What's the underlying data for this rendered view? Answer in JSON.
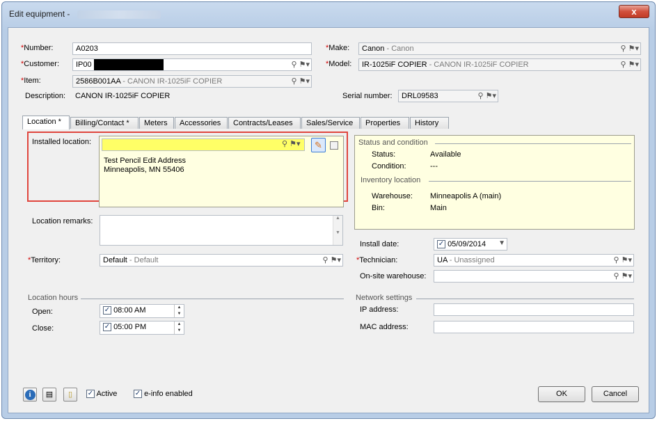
{
  "window": {
    "title": "Edit equipment -",
    "close_label": "x"
  },
  "header": {
    "number_label": "Number:",
    "number_value": "A0203",
    "customer_label": "Customer:",
    "customer_value": "IP00",
    "item_label": "Item:",
    "item_code": "2586B001AA",
    "item_desc": " - CANON IR-1025iF COPIER",
    "description_label": "Description:",
    "description_value": "CANON IR-1025iF COPIER",
    "make_label": "Make:",
    "make_code": "Canon",
    "make_desc": " - Canon",
    "model_label": "Model:",
    "model_code": "IR-1025iF COPIER",
    "model_desc": " - CANON IR-1025iF COPIER",
    "serial_label": "Serial number:",
    "serial_value": "DRL09583"
  },
  "tabs": [
    "Location *",
    "Billing/Contact *",
    "Meters",
    "Accessories",
    "Contracts/Leases",
    "Sales/Service",
    "Properties",
    "History"
  ],
  "location": {
    "installed_label": "Installed location:",
    "installed_value": "",
    "address_line1": "Test Pencil Edit Address",
    "address_line2": "Minneapolis, MN 55406",
    "remarks_label": "Location remarks:",
    "territory_label": "Territory:",
    "territory_code": "Default",
    "territory_desc": " - Default",
    "hours_title": "Location hours",
    "open_label": "Open:",
    "open_value": "08:00 AM",
    "close_label": "Close:",
    "close_value": "05:00 PM"
  },
  "status": {
    "title": "Status and condition",
    "status_label": "Status:",
    "status_value": "Available",
    "condition_label": "Condition:",
    "condition_value": "---",
    "inventory_title": "Inventory location",
    "warehouse_label": "Warehouse:",
    "warehouse_value": "Minneapolis A (main)",
    "bin_label": "Bin:",
    "bin_value": "Main"
  },
  "install": {
    "date_label": "Install date:",
    "date_value": "05/09/2014",
    "technician_label": "Technician:",
    "technician_code": "UA",
    "technician_desc": " - Unassigned",
    "onsite_label": "On-site warehouse:"
  },
  "network": {
    "title": "Network settings",
    "ip_label": "IP address:",
    "mac_label": "MAC address:"
  },
  "footer": {
    "active_label": "Active",
    "einfo_label": "e-info enabled",
    "ok_label": "OK",
    "cancel_label": "Cancel"
  },
  "icons": {
    "lookup": "⚲",
    "dropdown": "▾",
    "check": "✓"
  },
  "colors": {
    "required": "#d00000",
    "highlight": "#ffff66",
    "panel_yellow": "#ffffe1",
    "callout_red": "#e0453d"
  }
}
